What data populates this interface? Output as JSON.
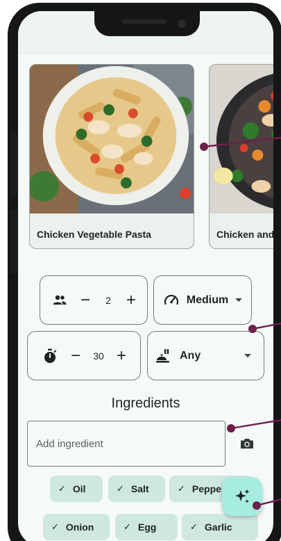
{
  "recipes": [
    {
      "title": "Chicken Vegetable Pasta",
      "image": "chicken-vegetable-pasta-photo"
    },
    {
      "title": "Chicken and",
      "image": "chicken-stir-fry-photo"
    }
  ],
  "servings": {
    "icon": "people-icon",
    "value": "2",
    "minus": "−",
    "plus": "+"
  },
  "difficulty": {
    "icon": "speedometer-icon",
    "value": "Medium"
  },
  "time": {
    "icon": "stopwatch-icon",
    "value": "30",
    "minus": "−",
    "plus": "+"
  },
  "cuisine": {
    "icon": "cloche-icon",
    "value": "Any"
  },
  "ingredients": {
    "heading": "Ingredients",
    "placeholder": "Add ingredient",
    "chips": [
      "Oil",
      "Salt",
      "Pepper",
      "Onion",
      "Egg",
      "Garlic"
    ],
    "check": "✓"
  },
  "fab": {
    "icon": "sparkles-icon"
  },
  "colors": {
    "accent": "#a6ede0",
    "chip": "#cfe7e1",
    "callout": "#6e1f4a",
    "frame": "#161616"
  }
}
